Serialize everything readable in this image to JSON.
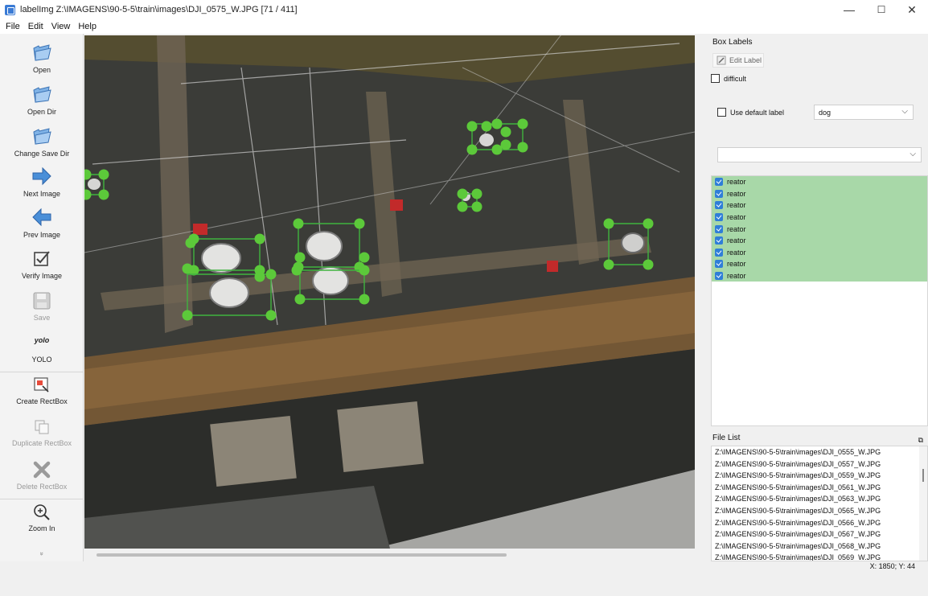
{
  "window": {
    "title": "labelImg Z:\\IMAGENS\\90-5-5\\train\\images\\DJI_0575_W.JPG [71 / 411]",
    "minimize": "—",
    "maximize": "☐",
    "close": "✕"
  },
  "menu": [
    "File",
    "Edit",
    "View",
    "Help"
  ],
  "toolbar": {
    "open": "Open",
    "open_dir": "Open Dir",
    "change_save_dir": "Change Save Dir",
    "next_image": "Next Image",
    "prev_image": "Prev Image",
    "verify_image": "Verify Image",
    "save": "Save",
    "yolo_icon": "yolo",
    "yolo": "YOLO",
    "create_rectbox": "Create RectBox",
    "duplicate_rectbox": "Duplicate RectBox",
    "delete_rectbox": "Delete RectBox",
    "zoom_in": "Zoom In",
    "more": "»"
  },
  "box_labels": {
    "title": "Box Labels",
    "edit_label": "Edit Label",
    "difficult": "difficult",
    "use_default_label": "Use default label",
    "default_label_value": "dog",
    "label_combo_value": "",
    "items": [
      "reator",
      "reator",
      "reator",
      "reator",
      "reator",
      "reator",
      "reator",
      "reator",
      "reator"
    ]
  },
  "file_list": {
    "title": "File List",
    "float_icon": "⧉",
    "items": [
      "Z:\\IMAGENS\\90-5-5\\train\\images\\DJI_0555_W.JPG",
      "Z:\\IMAGENS\\90-5-5\\train\\images\\DJI_0557_W.JPG",
      "Z:\\IMAGENS\\90-5-5\\train\\images\\DJI_0559_W.JPG",
      "Z:\\IMAGENS\\90-5-5\\train\\images\\DJI_0561_W.JPG",
      "Z:\\IMAGENS\\90-5-5\\train\\images\\DJI_0563_W.JPG",
      "Z:\\IMAGENS\\90-5-5\\train\\images\\DJI_0565_W.JPG",
      "Z:\\IMAGENS\\90-5-5\\train\\images\\DJI_0566_W.JPG",
      "Z:\\IMAGENS\\90-5-5\\train\\images\\DJI_0567_W.JPG",
      "Z:\\IMAGENS\\90-5-5\\train\\images\\DJI_0568_W.JPG",
      "Z:\\IMAGENS\\90-5-5\\train\\images\\DJI_0569_W.JPG"
    ]
  },
  "status": {
    "coords": "X: 1850; Y: 44"
  },
  "colors": {
    "handle": "#5cc93a",
    "box": "#3fb33f",
    "selected_label_bg": "#a8d8a8",
    "checkbox_blue": "#2f7ed8"
  }
}
